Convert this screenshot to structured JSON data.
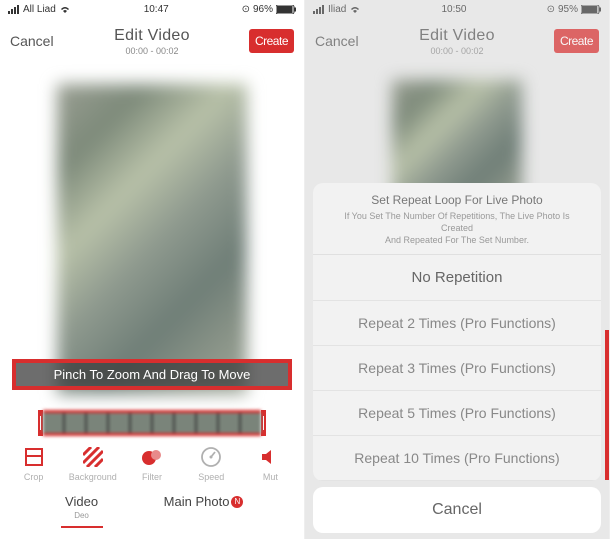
{
  "left": {
    "status": {
      "carrier": "All Liad",
      "time": "10:47",
      "battery": "96%",
      "wifi_icon": "wifi-icon",
      "signal_icon": "signal-icon",
      "alarm_icon": "alarm-icon",
      "orientation_icon": "orientation-lock-icon",
      "battery_icon": "battery-icon"
    },
    "nav": {
      "cancel": "Cancel",
      "title": "Edit Video",
      "subtitle": "00:00 - 00:02",
      "create": "Create"
    },
    "instruction": "Pinch To Zoom And Drag To Move",
    "tools": [
      {
        "name": "crop-tool",
        "label": "Crop",
        "color": "red",
        "icon": "crop-icon"
      },
      {
        "name": "background-tool",
        "label": "Background",
        "color": "red",
        "icon": "diagonal-lines-icon"
      },
      {
        "name": "filter-tool",
        "label": "Filter",
        "color": "red",
        "icon": "overlap-circles-icon"
      },
      {
        "name": "speed-tool",
        "label": "Speed",
        "color": "gray",
        "icon": "speedometer-icon"
      },
      {
        "name": "mute-tool",
        "label": "Mut",
        "color": "red",
        "icon": "speaker-icon"
      }
    ],
    "tabs": {
      "video": "Video",
      "video_sub": "Deo",
      "main_photo": "Main Photo",
      "badge": "N"
    }
  },
  "right": {
    "status": {
      "carrier": "Iliad",
      "time": "10:50",
      "battery": "95%"
    },
    "nav": {
      "cancel": "Cancel",
      "title": "Edit Video",
      "subtitle": "00:00 - 00:02",
      "create": "Create"
    },
    "sheet": {
      "title": "Set Repeat Loop For Live Photo",
      "desc_line1": "If You Set The Number Of Repetitions, The Live Photo Is Created",
      "desc_line2": "And Repeated For The Set Number.",
      "options": [
        {
          "label": "No Repetition",
          "emph": true
        },
        {
          "label": "Repeat 2 Times (Pro Functions)"
        },
        {
          "label": "Repeat 3 Times (Pro Functions)"
        },
        {
          "label": "Repeat 5 Times (Pro Functions)"
        },
        {
          "label": "Repeat 10 Times (Pro Functions)"
        }
      ],
      "cancel": "Cancel"
    }
  }
}
